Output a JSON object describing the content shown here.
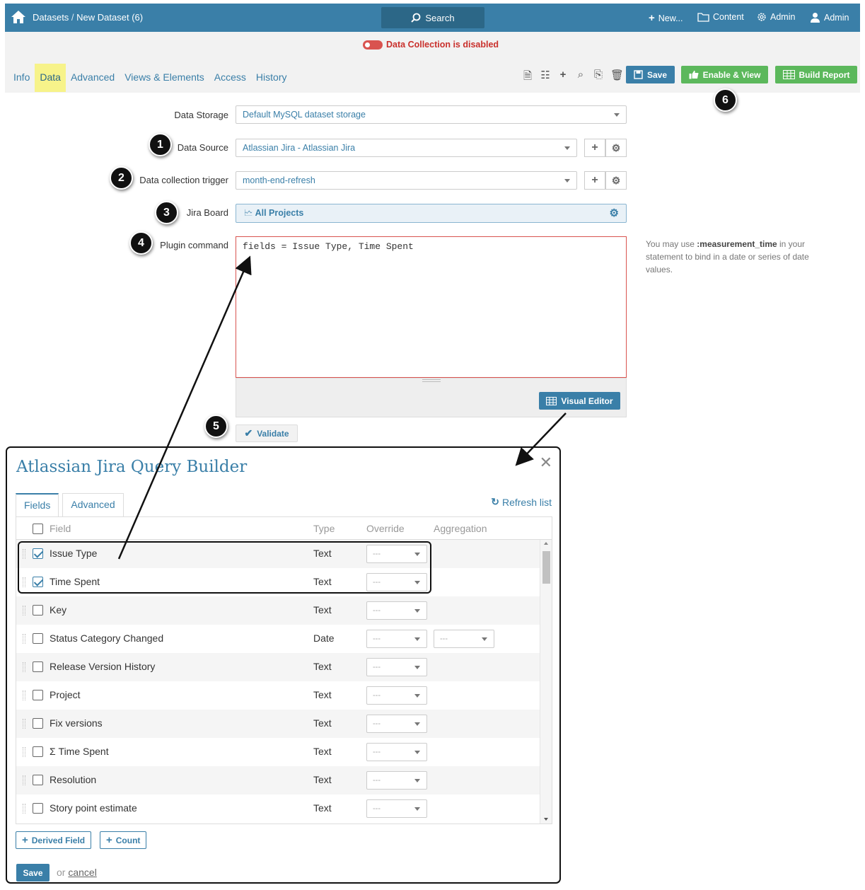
{
  "topbar": {
    "breadcrumb_root": "Datasets",
    "breadcrumb_sep": " / ",
    "breadcrumb_current": "New Dataset (6)",
    "search_label": "Search",
    "new_label": "New...",
    "content_label": "Content",
    "admin_menu_label": "Admin",
    "user_label": "Admin"
  },
  "status": {
    "data_collection": "Data Collection is disabled"
  },
  "tabs": [
    "Info",
    "Data",
    "Advanced",
    "Views & Elements",
    "Access",
    "History"
  ],
  "toolbar": {
    "save_label": "Save",
    "enable_view_label": "Enable & View",
    "build_report_label": "Build Report"
  },
  "form": {
    "data_storage_label": "Data Storage",
    "data_storage_value": "Default MySQL dataset storage",
    "data_source_label": "Data Source",
    "data_source_value": "Atlassian Jira - Atlassian Jira",
    "trigger_label": "Data collection trigger",
    "trigger_value": "month-end-refresh",
    "jira_board_label": "Jira Board",
    "jira_board_value": "All Projects",
    "plugin_command_label": "Plugin command",
    "plugin_command_value": "fields = Issue Type, Time Spent",
    "visual_editor_label": "Visual Editor",
    "validate_label": "Validate",
    "hint_pre": "You may use ",
    "hint_bold": ":measurement_time",
    "hint_post": " in your statement to bind in a date or series of date values."
  },
  "callouts": [
    "1",
    "2",
    "3",
    "4",
    "5",
    "6"
  ],
  "modal": {
    "title": "Atlassian Jira Query Builder",
    "tabs": [
      "Fields",
      "Advanced"
    ],
    "refresh_label": "Refresh list",
    "columns": {
      "field": "Field",
      "type": "Type",
      "override": "Override",
      "aggregation": "Aggregation"
    },
    "rows": [
      {
        "name": "Issue Type",
        "type": "Text",
        "checked": true,
        "override": "---"
      },
      {
        "name": "Time Spent",
        "type": "Text",
        "checked": true,
        "override": "---"
      },
      {
        "name": "Key",
        "type": "Text",
        "checked": false,
        "override": "---"
      },
      {
        "name": "Status Category Changed",
        "type": "Date",
        "checked": false,
        "override": "---",
        "aggregation": "---"
      },
      {
        "name": "Release Version History",
        "type": "Text",
        "checked": false,
        "override": "---"
      },
      {
        "name": "Project",
        "type": "Text",
        "checked": false,
        "override": "---"
      },
      {
        "name": "Fix versions",
        "type": "Text",
        "checked": false,
        "override": "---"
      },
      {
        "name": "Σ Time Spent",
        "type": "Text",
        "checked": false,
        "override": "---"
      },
      {
        "name": "Resolution",
        "type": "Text",
        "checked": false,
        "override": "---"
      },
      {
        "name": "Story point estimate",
        "type": "Text",
        "checked": false,
        "override": "---"
      }
    ],
    "derived_field_label": "Derived Field",
    "count_label": "Count",
    "save_label": "Save",
    "or_label": "or",
    "cancel_label": "cancel"
  }
}
